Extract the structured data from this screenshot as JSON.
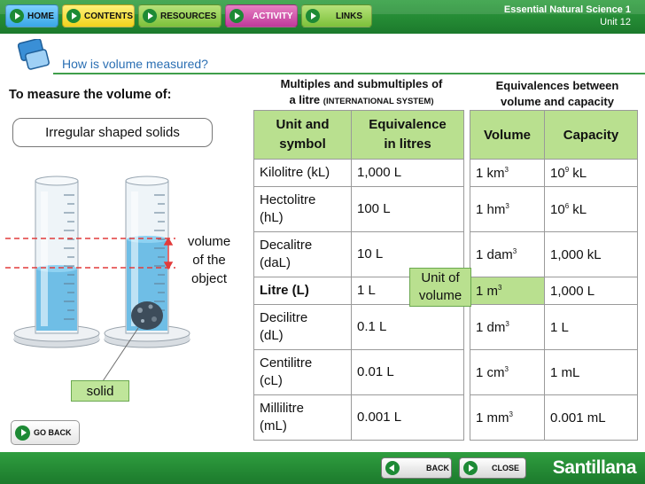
{
  "nav": {
    "home": "HOME",
    "contents": "CONTENTS",
    "resources": "RESOURCES",
    "activity": "ACTIVITY",
    "links": "LINKS"
  },
  "course": {
    "name": "Essential Natural Science 1",
    "unit": "Unit 12"
  },
  "heading": "How is volume measured?",
  "left": {
    "measure_label": "To measure the volume of:",
    "object_pill": "Irregular shaped solids",
    "volume_label_line1": "volume",
    "volume_label_line2": "of the",
    "volume_label_line3": "object",
    "solid_label": "solid",
    "go_back": "GO BACK"
  },
  "table1": {
    "title_line1": "Multiples and submultiples of",
    "title_line2": "a litre",
    "title_note": "(INTERNATIONAL SYSTEM)",
    "header_col1_line1": "Unit and",
    "header_col1_line2": "symbol",
    "header_col2_line1": "Equivalence",
    "header_col2_line2": "in litres",
    "rows": [
      {
        "unit": "Kilolitre (kL)",
        "equiv": "1,000 L"
      },
      {
        "unit_line1": "Hectolitre",
        "unit_line2": "(hL)",
        "equiv": "100 L"
      },
      {
        "unit_line1": "Decalitre",
        "unit_line2": "(daL)",
        "equiv": "10 L"
      },
      {
        "unit": "Litre (L)",
        "equiv": "1 L"
      },
      {
        "unit_line1": "Decilitre",
        "unit_line2": "(dL)",
        "equiv": "0.1 L"
      },
      {
        "unit_line1": "Centilitre",
        "unit_line2": "(cL)",
        "equiv": "0.01 L"
      },
      {
        "unit_line1": "Millilitre",
        "unit_line2": "(mL)",
        "equiv": "0.001 L"
      }
    ]
  },
  "table2": {
    "title_line1": "Equivalences between",
    "title_line2": "volume and capacity",
    "header_col1": "Volume",
    "header_col2": "Capacity",
    "rows": [
      {
        "volume": "1 km",
        "exp": "3",
        "capacity": "10",
        "cap_exp": "9",
        "cap_unit": " kL"
      },
      {
        "volume": "1 hm",
        "exp": "3",
        "capacity": "10",
        "cap_exp": "6",
        "cap_unit": " kL"
      },
      {
        "volume": "1 dam",
        "exp": "3",
        "capacity": "1,000 kL"
      },
      {
        "volume": "1 m",
        "exp": "3",
        "capacity": "1,000 L"
      },
      {
        "volume": "1 dm",
        "exp": "3",
        "capacity": "1 L"
      },
      {
        "volume": "1 cm",
        "exp": "3",
        "capacity": "1 mL"
      },
      {
        "volume": "1 mm",
        "exp": "3",
        "capacity": "0.001 mL"
      }
    ]
  },
  "callout": {
    "line1": "Unit of",
    "line2": "volume"
  },
  "bottom": {
    "back": "BACK",
    "close": "CLOSE",
    "brand": "Santillana"
  },
  "colors": {
    "green_bar": "#1c7a2c",
    "highlight": "#b9e08f",
    "heading_blue": "#2b6fb3"
  }
}
